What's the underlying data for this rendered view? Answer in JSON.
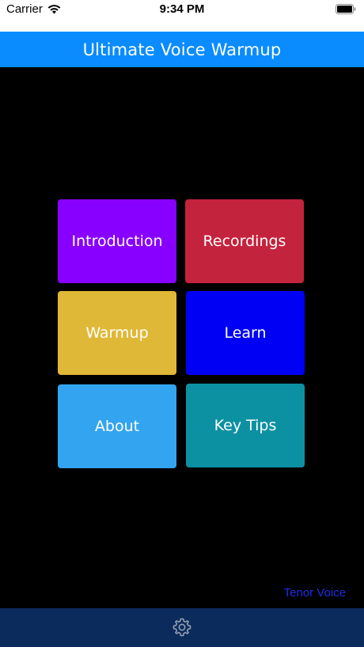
{
  "colors": {
    "nav_background": "#0a8cff",
    "bottom_bar_background": "#0a2b5c",
    "tile_introduction": "#8800ff",
    "tile_recordings": "#c4233d",
    "tile_warmup": "#e0b837",
    "tile_learn": "#0000f5",
    "tile_about": "#33a4f0",
    "tile_key_tips": "#0c91a3",
    "footer_link": "#1a2ee6",
    "settings_icon": "#9aa3b3"
  },
  "status_bar": {
    "carrier": "Carrier",
    "time": "9:34 PM",
    "wifi_icon": "wifi-icon",
    "battery_icon": "battery-icon"
  },
  "nav": {
    "title": "Ultimate Voice Warmup"
  },
  "tiles": [
    {
      "label": "Introduction"
    },
    {
      "label": "Recordings"
    },
    {
      "label": "Warmup"
    },
    {
      "label": "Learn"
    },
    {
      "label": "About"
    },
    {
      "label": "Key Tips"
    }
  ],
  "footer": {
    "link_label": "Tenor Voice"
  },
  "bottom_bar": {
    "settings_icon": "gear-icon"
  }
}
